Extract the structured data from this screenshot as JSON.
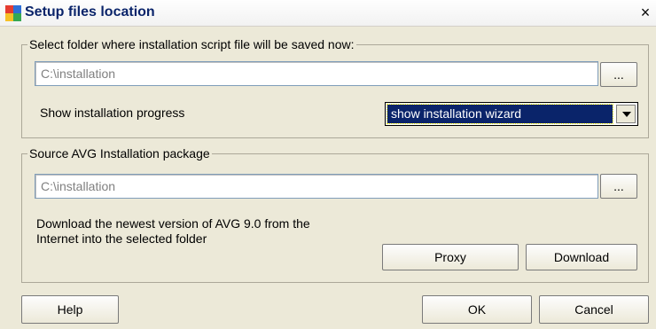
{
  "window": {
    "title": "Setup files location",
    "close_label": "×"
  },
  "script_group": {
    "title": "Select folder where installation script file will be saved now:",
    "folder_value": "C:\\installation",
    "browse_label": "...",
    "progress_label": "Show installation progress",
    "progress_selected": "show installation wizard"
  },
  "source_group": {
    "title": "Source AVG Installation package",
    "folder_value": "C:\\installation",
    "browse_label": "...",
    "download_text_line1": "Download the newest version of AVG 9.0 from the",
    "download_text_line2": "Internet into the selected folder",
    "proxy_label": "Proxy",
    "download_label": "Download"
  },
  "footer": {
    "help_label": "Help",
    "ok_label": "OK",
    "cancel_label": "Cancel"
  },
  "colors": {
    "title_text": "#0a246a",
    "selection": "#0a246a",
    "dialog_bg": "#ece9d8"
  }
}
